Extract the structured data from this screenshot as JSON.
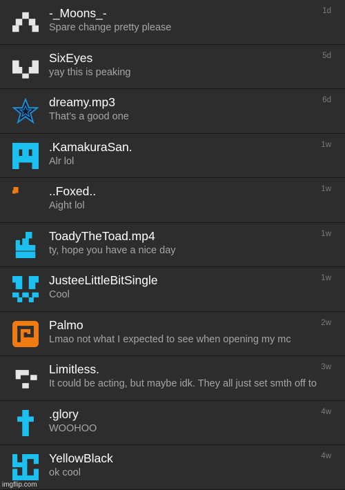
{
  "conversations": [
    {
      "name": "-_Moons_-",
      "preview": "Spare change pretty please",
      "time": "1d",
      "avatar_icon": "white-pixel-cross-icon",
      "avatar_color": "#e6e6e6"
    },
    {
      "name": "SixEyes",
      "preview": "yay this is peaking",
      "time": "5d",
      "avatar_icon": "white-pixel-bracket-icon",
      "avatar_color": "#e6e6e6"
    },
    {
      "name": "dreamy.mp3",
      "preview": "That’s a good one",
      "time": "6d",
      "avatar_icon": "blue-star-icon",
      "avatar_color": "#1f8fd6"
    },
    {
      "name": ".KamakuraSan.",
      "preview": "Alr lol",
      "time": "1w",
      "avatar_icon": "blue-pixel-invader-icon",
      "avatar_color": "#1cc0f0"
    },
    {
      "name": "..Foxed..",
      "preview": "Aight lol",
      "time": "1w",
      "avatar_icon": "orange-pixel-fragment-icon",
      "avatar_color": "#f07b12"
    },
    {
      "name": "ToadyTheToad.mp4",
      "preview": "ty, hope you have a nice day",
      "time": "1w",
      "avatar_icon": "blue-pixel-cactus-icon",
      "avatar_color": "#1cc0f0"
    },
    {
      "name": "JusteeLittleBitSingle",
      "preview": "Cool",
      "time": "1w",
      "avatar_icon": "blue-pixel-face-icon",
      "avatar_color": "#1cc0f0"
    },
    {
      "name": "Palmo",
      "preview": "Lmao not what I expected to see when opening my mc",
      "time": "2w",
      "avatar_icon": "orange-pixel-spiral-icon",
      "avatar_color": "#f07b12"
    },
    {
      "name": "Limitless.",
      "preview": "It could be acting, but maybe idk. They all just set smth off to",
      "time": "3w",
      "avatar_icon": "white-pixel-blocks-icon",
      "avatar_color": "#e6e6e6"
    },
    {
      "name": ".glory",
      "preview": "WOOHOO",
      "time": "4w",
      "avatar_icon": "blue-pixel-cross-icon",
      "avatar_color": "#1cc0f0"
    },
    {
      "name": "YellowBlack",
      "preview": "ok cool",
      "time": "4w",
      "avatar_icon": "blue-pixel-swirl-icon",
      "avatar_color": "#1cc0f0"
    }
  ],
  "watermark": "imgflip.com"
}
